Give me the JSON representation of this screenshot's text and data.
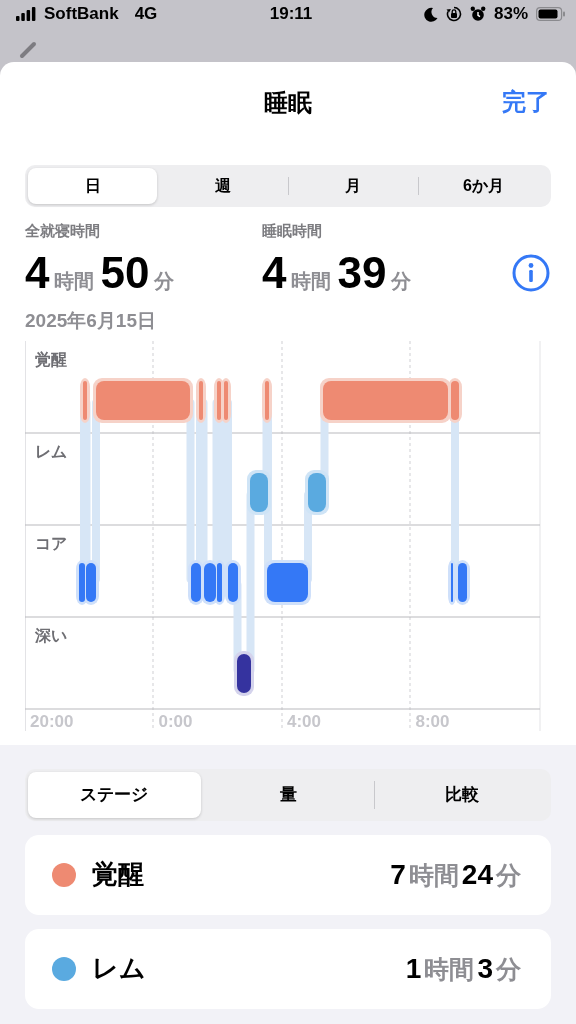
{
  "status_bar": {
    "carrier": "SoftBank",
    "network": "4G",
    "time": "19:11",
    "battery": "83%"
  },
  "sheet": {
    "title": "睡眠",
    "done": "完了"
  },
  "period_tabs": [
    {
      "label": "日",
      "selected": true
    },
    {
      "label": "週",
      "selected": false
    },
    {
      "label": "月",
      "selected": false
    },
    {
      "label": "6か月",
      "selected": false
    }
  ],
  "stats": [
    {
      "label": "全就寝時間",
      "parts": [
        {
          "value": "4",
          "unit": "時間"
        },
        {
          "value": "50",
          "unit": "分"
        }
      ]
    },
    {
      "label": "睡眠時間",
      "parts": [
        {
          "value": "4",
          "unit": "時間"
        },
        {
          "value": "39",
          "unit": "分"
        }
      ]
    }
  ],
  "date": "2025年6月15日",
  "sleep_chart": {
    "stages": [
      "覚醒",
      "レム",
      "コア",
      "深い"
    ],
    "time_labels": [
      "20:00",
      "0:00",
      "4:00",
      "8:00"
    ]
  },
  "view_tabs": [
    {
      "label": "ステージ",
      "selected": true
    },
    {
      "label": "量",
      "selected": false
    },
    {
      "label": "比較",
      "selected": false
    }
  ],
  "stage_totals": [
    {
      "name": "覚醒",
      "color": "#ee8a72",
      "parts": [
        {
          "value": "7",
          "unit": "時間"
        },
        {
          "value": "24",
          "unit": "分"
        }
      ]
    },
    {
      "name": "レム",
      "color": "#5aaae0",
      "parts": [
        {
          "value": "1",
          "unit": "時間"
        },
        {
          "value": "3",
          "unit": "分"
        }
      ]
    }
  ]
}
